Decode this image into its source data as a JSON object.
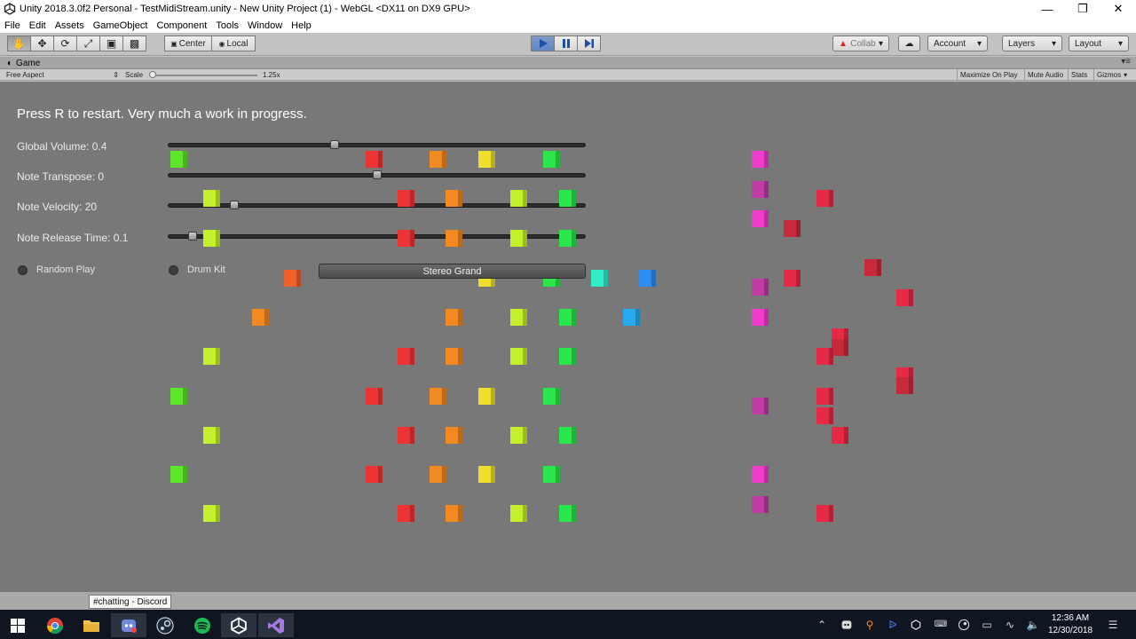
{
  "window": {
    "title": "Unity 2018.3.0f2 Personal - TestMidiStream.unity - New Unity Project (1) - WebGL <DX11 on DX9 GPU>"
  },
  "menu": [
    "File",
    "Edit",
    "Assets",
    "GameObject",
    "Component",
    "Tools",
    "Window",
    "Help"
  ],
  "toolbar": {
    "pivot_label": "Center",
    "space_label": "Local",
    "collab_label": "Collab",
    "account_label": "Account",
    "layers_label": "Layers",
    "layout_label": "Layout"
  },
  "game_tab": {
    "title": "Game",
    "aspect": "Free Aspect",
    "scale_label": "Scale",
    "scale_value": "1.25x",
    "scale_fraction": 0.02,
    "maximize": "Maximize On Play",
    "mute": "Mute Audio",
    "stats": "Stats",
    "gizmos": "Gizmos"
  },
  "game": {
    "heading": "Press R to restart. Very much a work in progress.",
    "sliders": [
      {
        "label": "Global Volume: 0.4",
        "fraction": 0.4
      },
      {
        "label": "Note Transpose: 0",
        "fraction": 0.5
      },
      {
        "label": "Note Velocity: 20",
        "fraction": 0.16
      },
      {
        "label": "Note Release Time: 0.1",
        "fraction": 0.06
      }
    ],
    "random_play": "Random Play",
    "drum_kit": "Drum Kit",
    "instrument": "Stereo Grand"
  },
  "colors": {
    "green": "#5ee62a",
    "lime": "#c4f02c",
    "red": "#ec3434",
    "orange": "#f28a22",
    "yellow": "#f0de2c",
    "bright_green": "#2ae64a",
    "teal": "#32eec8",
    "blue": "#2e8cf2",
    "skyblue": "#28aaf0",
    "magenta": "#f03ccc",
    "purple": "#c23ca8",
    "crimson": "#e62a46",
    "darkred": "#c82a3c",
    "redorange": "#f0602a"
  },
  "tooltip": "#chatting - Discord",
  "clock": {
    "time": "12:36 AM",
    "date": "12/30/2018"
  }
}
